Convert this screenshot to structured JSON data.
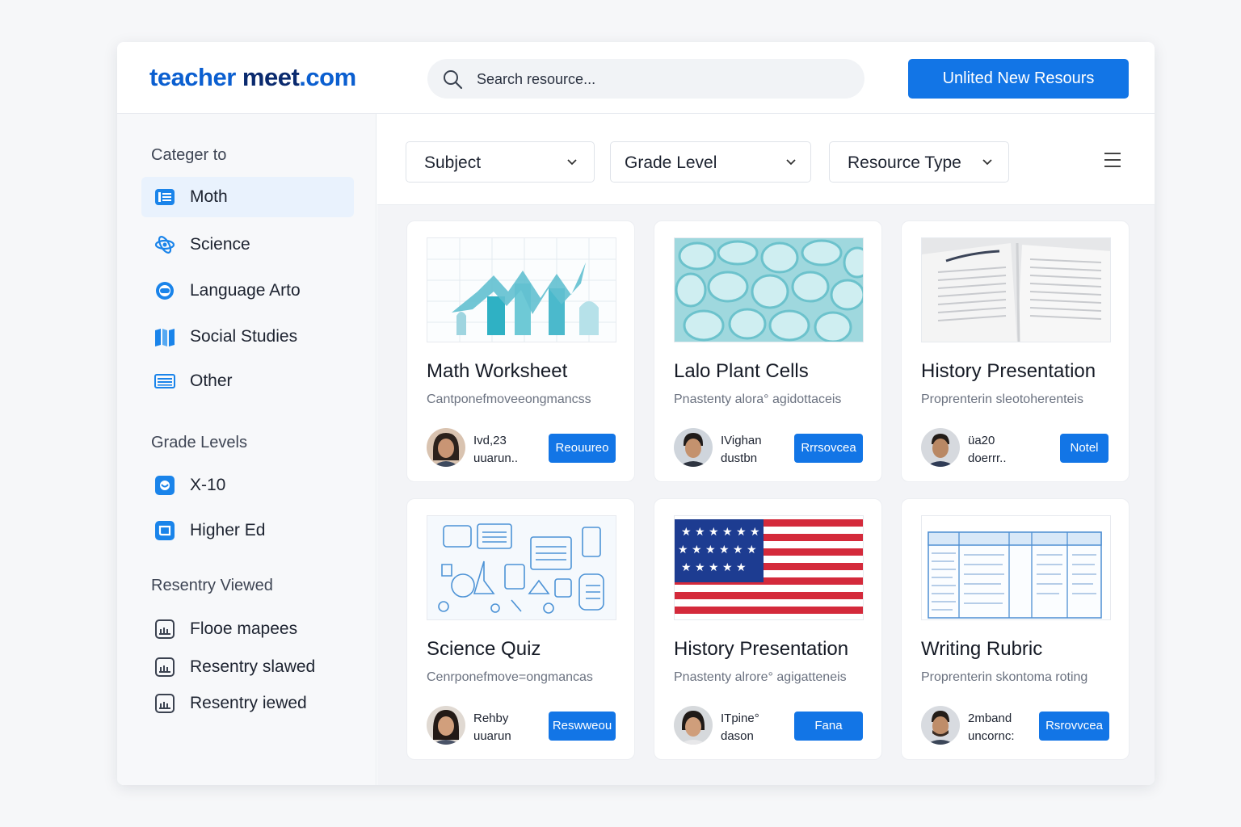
{
  "header": {
    "logo": {
      "part1": "teacher",
      "part2": " meet",
      "part3": ".com"
    },
    "search_placeholder": "Search resource...",
    "cta_label": "Unlited New Resours"
  },
  "sidebar": {
    "categories_title": "Categer to",
    "categories": [
      {
        "label": "Moth",
        "icon": "book-icon",
        "active": true
      },
      {
        "label": "Science",
        "icon": "atom-icon"
      },
      {
        "label": "Language Arto",
        "icon": "speech-icon"
      },
      {
        "label": "Social Studies",
        "icon": "map-icon"
      },
      {
        "label": "Other",
        "icon": "list-icon"
      }
    ],
    "grade_title": "Grade Levels",
    "grades": [
      {
        "label": "X-10",
        "icon": "school-icon"
      },
      {
        "label": "Higher Ed",
        "icon": "graduation-icon"
      }
    ],
    "recent_title": "Resentry Viewed",
    "recent": [
      {
        "label": "Flooe mapees",
        "icon": "calendar-icon"
      },
      {
        "label": "Resentry slawed",
        "icon": "calendar-icon"
      },
      {
        "label": "Resentry iewed",
        "icon": "calendar-icon"
      }
    ]
  },
  "filters": {
    "subject": "Subject",
    "grade": "Grade Level",
    "type": "Resource Type"
  },
  "cards": [
    {
      "title": "Math Worksheet",
      "desc": "Cantponefmoveeongmancss",
      "meta1": "Ivd,23",
      "meta2": "uuarun..",
      "button": "Reouureo",
      "thumb": "chart-thumbnail"
    },
    {
      "title": "Lalo Plant Cells",
      "desc": "Pnastenty alora° agidottaceis",
      "meta1": "IVighan",
      "meta2": "dustbn",
      "button": "Rrrsovcea",
      "thumb": "cells-thumbnail"
    },
    {
      "title": "History Presentation",
      "desc": "Proprenterin sleotoherenteis",
      "meta1": "üa20",
      "meta2": "doerrr..",
      "button": "Notel",
      "thumb": "book-thumbnail"
    },
    {
      "title": "Science Quiz",
      "desc": "Cenrponefmove=ongmancas",
      "meta1": "Rehby",
      "meta2": "uuarun",
      "button": "Reswweou",
      "thumb": "sketch-thumbnail"
    },
    {
      "title": "History Presentation",
      "desc": "Pnastenty alrore° agigatteneis",
      "meta1": "ITpine°",
      "meta2": "dason",
      "button": "Fana",
      "thumb": "flag-thumbnail"
    },
    {
      "title": "Writing Rubric",
      "desc": "Proprenterin skontoma roting",
      "meta1": "2mband",
      "meta2": "uncornc:",
      "button": "Rsrovvcea",
      "thumb": "table-thumbnail"
    }
  ],
  "colors": {
    "accent": "#1275e6",
    "logo_dark": "#0a2a6e",
    "active_bg": "#e9f2fd"
  }
}
